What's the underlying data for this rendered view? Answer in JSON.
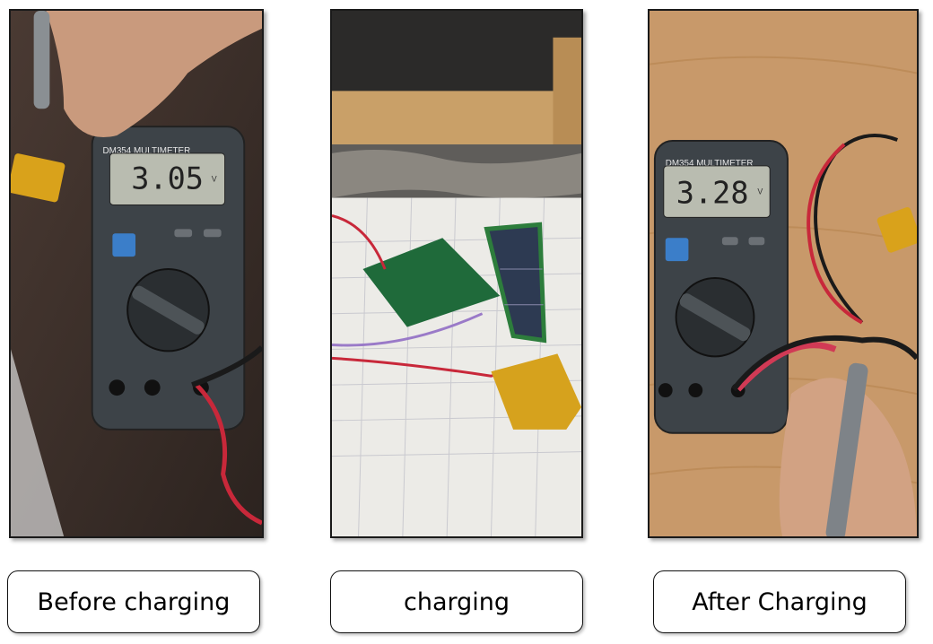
{
  "panels": [
    {
      "caption": "Before charging",
      "meter": {
        "model": "DM354 MULTIMETER",
        "reading": "3.05",
        "unit": "V"
      }
    },
    {
      "caption": "charging"
    },
    {
      "caption": "After Charging",
      "meter": {
        "model": "DM354 MULTIMETER",
        "reading": "3.28",
        "unit": "V"
      }
    }
  ]
}
